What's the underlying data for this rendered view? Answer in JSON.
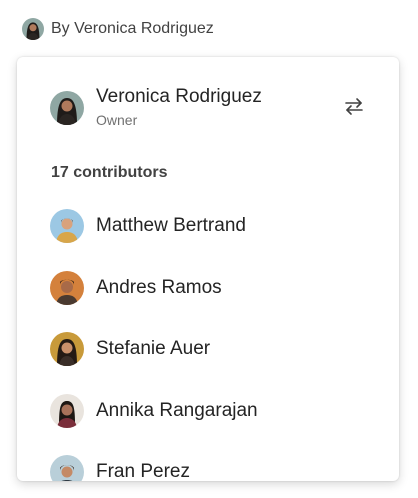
{
  "byline": {
    "text": "By Veronica Rodriguez",
    "avatar_icon": "person-avatar-icon"
  },
  "owner": {
    "name": "Veronica Rodriguez",
    "role": "Owner",
    "avatar_icon": "person-avatar-icon",
    "action_icon": "swap-arrows-icon"
  },
  "contributors": {
    "heading": "17 contributors",
    "items": [
      {
        "name": "Matthew Bertrand",
        "avatar_icon": "person-avatar-icon"
      },
      {
        "name": "Andres Ramos",
        "avatar_icon": "person-avatar-icon"
      },
      {
        "name": "Stefanie Auer",
        "avatar_icon": "person-avatar-icon"
      },
      {
        "name": "Annika Rangarajan",
        "avatar_icon": "person-avatar-icon"
      },
      {
        "name": "Fran Perez",
        "avatar_icon": "person-avatar-icon"
      }
    ]
  },
  "colors": {
    "text_primary": "#242424",
    "text_secondary": "#707070",
    "card_background": "#ffffff"
  }
}
